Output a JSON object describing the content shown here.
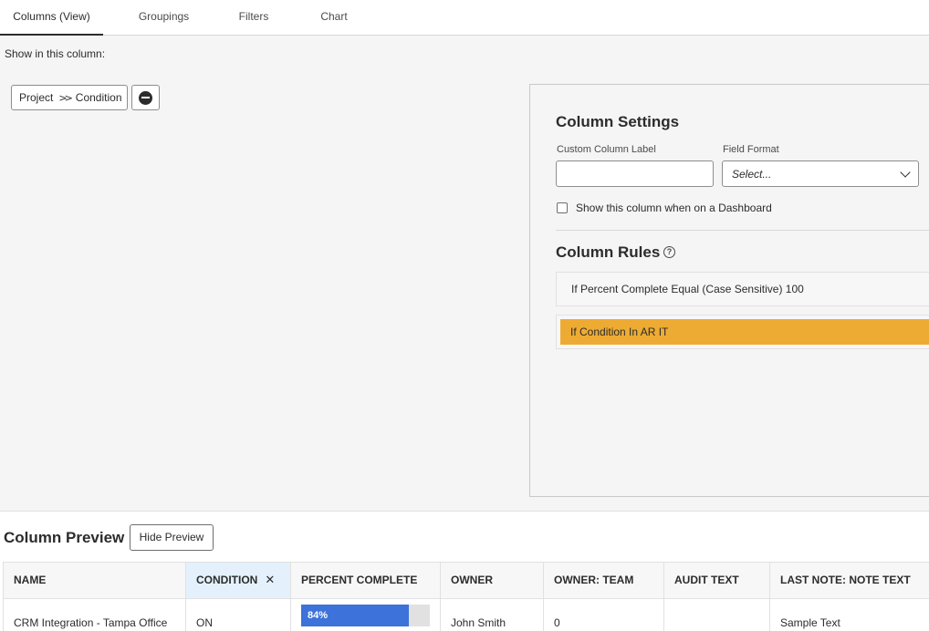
{
  "tabs": [
    {
      "label": "Columns (View)",
      "active": true
    },
    {
      "label": "Groupings",
      "active": false
    },
    {
      "label": "Filters",
      "active": false
    },
    {
      "label": "Chart",
      "active": false
    }
  ],
  "show_in_column_label": "Show in this column:",
  "field_path": {
    "parent": "Project",
    "separator": ">>",
    "field": "Condition"
  },
  "column_settings": {
    "title": "Column Settings",
    "custom_label": {
      "label": "Custom Column Label",
      "value": ""
    },
    "field_format": {
      "label": "Field Format",
      "placeholder": "Select..."
    },
    "dashboard_checkbox": {
      "label": "Show this column when on a Dashboard",
      "checked": false
    }
  },
  "column_rules": {
    "title": "Column Rules",
    "help_glyph": "?",
    "rules": [
      {
        "text": "If Percent Complete Equal (Case Sensitive) 100",
        "color": ""
      },
      {
        "text": "If Condition In AR IT",
        "color": "#eeab33"
      }
    ]
  },
  "preview": {
    "title": "Column Preview",
    "hide_button": "Hide Preview",
    "headers": [
      "NAME",
      "CONDITION",
      "PERCENT COMPLETE",
      "OWNER",
      "OWNER: TEAM",
      "AUDIT TEXT",
      "LAST NOTE: NOTE TEXT"
    ],
    "remove_glyph": "✕",
    "row": {
      "name": "CRM Integration - Tampa Office",
      "condition": "ON",
      "percent_complete": {
        "label": "84%",
        "value": 0.84
      },
      "owner": "John Smith",
      "owner_team": "0",
      "audit_text": "",
      "last_note": "Sample Text"
    }
  },
  "colors": {
    "accent_rule": "#eeab33",
    "progress": "#3c72d9",
    "selected_header": "#e4f1fd"
  }
}
